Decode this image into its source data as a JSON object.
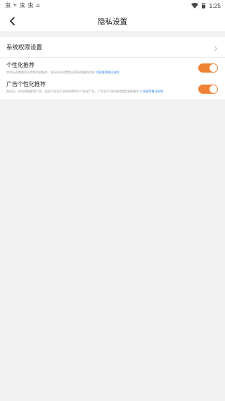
{
  "status": {
    "time": "1:25",
    "left_icons": [
      "虫",
      "⌗",
      "虫",
      "虫",
      "⌂"
    ]
  },
  "header": {
    "title": "隐私设置"
  },
  "permission": {
    "label": "系统权限设置"
  },
  "items": [
    {
      "title": "个性化推荐",
      "desc": "实时标志需要用于提供内容服务，保证所在位置附近更高准确的内容 ",
      "link": "内容推荐算法说明",
      "enabled": true
    },
    {
      "title": "广告个性化推荐",
      "desc": "关闭后，你仍然能看到广告，但在产品里不会向你提供与个性化广告，广告在不同信息时都是满意服务 ",
      "link": "广告推荐算法说明",
      "enabled": true
    }
  ],
  "colors": {
    "accent": "#f08234",
    "link": "#2a86e8"
  }
}
